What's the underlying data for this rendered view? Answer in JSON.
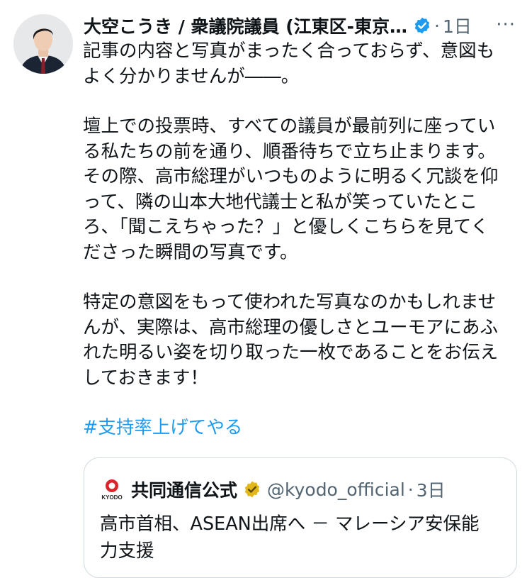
{
  "post": {
    "author_name": "大空こうき / 衆議院議員 (江東区-東京…",
    "time": "1日",
    "separator": "·",
    "more": "···",
    "paragraphs": [
      "記事の内容と写真がまったく合っておらず、意図も\nよく分かりませんが――。",
      "壇上での投票時、すべての議員が最前列に座ってい\nる私たちの前を通り、順番待ちで立ち止まります。\nその際、高市総理がいつものように明るく冗談を仰\nって、隣の山本大地代議士と私が笑っていたとこ\nろ、「聞こえちゃった？」と優しくこちらを見てく\nださった瞬間の写真です。",
      "特定の意図をもって使われた写真なのかもしれませ\nんが、実際は、高市総理の優しさとユーモアにあふ\nれた明るい姿を切り取った一枚であることをお伝え\nしておきます！"
    ],
    "hashtag": "#支持率上げてやる"
  },
  "quote": {
    "logo_text": "KYODO",
    "name": "共同通信公式",
    "handle": "@kyodo_official",
    "separator": "·",
    "time": "3日",
    "text": "高市首相、ASEAN出席へ － マレーシア安保能\n力支援"
  },
  "colors": {
    "link": "#1d9bf0",
    "verified_blue": "#1d9bf0",
    "verified_gold": "#e2b719",
    "secondary_text": "#536471",
    "border": "#cfd9de"
  },
  "icons": {
    "verified": "verified-badge-icon",
    "org_verified": "gold-check-icon",
    "more": "more-icon"
  }
}
